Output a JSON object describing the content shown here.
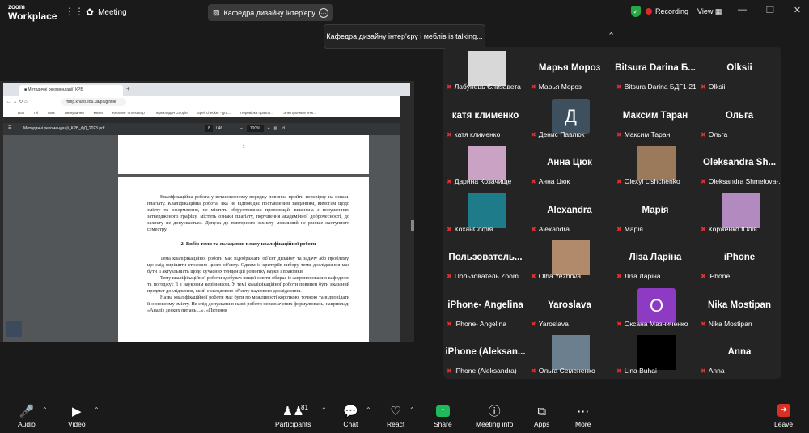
{
  "app": {
    "logo_line1": "zoom",
    "logo_line2": "Workplace",
    "menu_label": "Meeting",
    "menu_more": "⋮⋮"
  },
  "titlebar": {
    "meeting_title": "Кафедра дизайну інтер'єру і ме",
    "recording_label": "Recording",
    "view_label": "View"
  },
  "banner": {
    "talking_text": "Кафедра дизайну інтер'єру і меблів is talking..."
  },
  "shared_screen": {
    "browser_tab": "Методичні рекомендації_КРБ",
    "url": "mmp.knutd.edu.ua/pluginfile",
    "bookmarks": [
      "Dan",
      "rel",
      "max",
      "Іменування",
      "книги",
      "Remove Timestamp",
      "Перекладач Google",
      "Spell checker - gra...",
      "Перевірка правоп...",
      "Электронные книг..."
    ],
    "pdf_filename": "Методичні рекомендації_КРБ_ФД_2023.pdf",
    "pdf_page": "8",
    "pdf_total": "/ 46",
    "pdf_zoom": "100%",
    "page_top_number": "7",
    "para1": "Кваліфікаційна робота у встановленому порядку повинна пройти перевірку на ознаки плагіату. Кваліфікаційна робота, яка не відповідає поставленим завданням, вимогам щодо змісту та оформлення, не містить обґрунтованих пропозицій, виконана з порушенням затвердженого графіку, містить ознаки плагіату, порушення академічної доброчесності, до захисту не допускається. Допуск до повторного захисту можливий не раніше наступного семестру.",
    "heading": "2. Вибір теми та складання плану кваліфікаційної роботи",
    "para2": "Тема кваліфікаційної роботи має відображати об`єкт дизайну та задачу або проблему, що слід вирішити стосовно цього об'єкту. Одним із критеріїв вибору теми дослідження має бути її актуальність щодо сучасних тенденцій розвитку науки і практики.",
    "para3": "Тему кваліфікаційної роботи здобувач вищої освіти обирає із запропонованих кафедрою та погоджує її з науковим керівником. У темі кваліфікаційної роботи повинен бути вказаний предмет дослідження, який є складовою об'єкту наукового дослідження.",
    "para4": "Назва кваліфікаційної роботи має бути по можливості короткою, точною та відповідати її основному змісту. Не слід допускати в назві роботи невизначених формулювань, наприклад: «Аналіз деяких питань ...», «Питання"
  },
  "participants_grid": [
    {
      "big": "",
      "caption": "Лабунець Єлизавета",
      "avatar": "photo",
      "color": "#d8d8d8"
    },
    {
      "big": "Марья Мороз",
      "caption": "Марья Мороз"
    },
    {
      "big": "Bitsura Darina Б...",
      "caption": "Bitsura Darina БДГ1-21"
    },
    {
      "big": "Olksii",
      "caption": "Olksii"
    },
    {
      "big": "катя клименко",
      "caption": "катя клименко"
    },
    {
      "big": "",
      "caption": "Денис Павлюк",
      "avatar": "initial",
      "initial": "Д",
      "color": "#3e4f5e"
    },
    {
      "big": "Максим Таран",
      "caption": "Максим Таран"
    },
    {
      "big": "Ольга",
      "caption": "Ольга"
    },
    {
      "big": "",
      "caption": "Дарина Козачище",
      "avatar": "photo",
      "color": "#c9a2c4"
    },
    {
      "big": "Анна Цюк",
      "caption": "Анна Цюк"
    },
    {
      "big": "",
      "caption": "Olexyi Lishchenko",
      "avatar": "photo",
      "color": "#9b7a5c"
    },
    {
      "big": "Oleksandra Sh...",
      "caption": "Oleksandra Shmelova-..."
    },
    {
      "big": "",
      "caption": "КоханСофія",
      "avatar": "photo",
      "color": "#1e7b8a"
    },
    {
      "big": "Alexandra",
      "caption": "Alexandra"
    },
    {
      "big": "Марія",
      "caption": "Марія"
    },
    {
      "big": "",
      "caption": "Корженко Юлія",
      "avatar": "photo",
      "color": "#b38ac0"
    },
    {
      "big": "Пользователь...",
      "caption": "Пользователь Zoom"
    },
    {
      "big": "",
      "caption": "Olha Yezhova",
      "avatar": "photo",
      "color": "#b08a6a"
    },
    {
      "big": "Ліза Ларіна",
      "caption": "Ліза Ларіна"
    },
    {
      "big": "iPhone",
      "caption": "iPhone"
    },
    {
      "big": "iPhone- Angelina",
      "caption": "iPhone- Angelina"
    },
    {
      "big": "Yaroslava",
      "caption": "Yaroslava"
    },
    {
      "big": "",
      "caption": "Оксана Мазниченко",
      "avatar": "initial",
      "initial": "O",
      "color": "#8e3bc4"
    },
    {
      "big": "Nika Mostipan",
      "caption": "Nika Mostipan"
    },
    {
      "big": "iPhone (Aleksan...",
      "caption": "iPhone (Aleksandra)"
    },
    {
      "big": "",
      "caption": "Ольга Семененко",
      "avatar": "photo",
      "color": "#6b7f8e"
    },
    {
      "big": "",
      "caption": "Lina Buhai",
      "avatar": "photo",
      "color": "#000000"
    },
    {
      "big": "Anna",
      "caption": "Anna"
    }
  ],
  "toolbar": {
    "audio": "Audio",
    "video": "Video",
    "participants": "Participants",
    "participant_count": "81",
    "chat": "Chat",
    "react": "React",
    "share": "Share",
    "meeting_info": "Meeting info",
    "apps": "Apps",
    "more": "More",
    "leave": "Leave"
  }
}
